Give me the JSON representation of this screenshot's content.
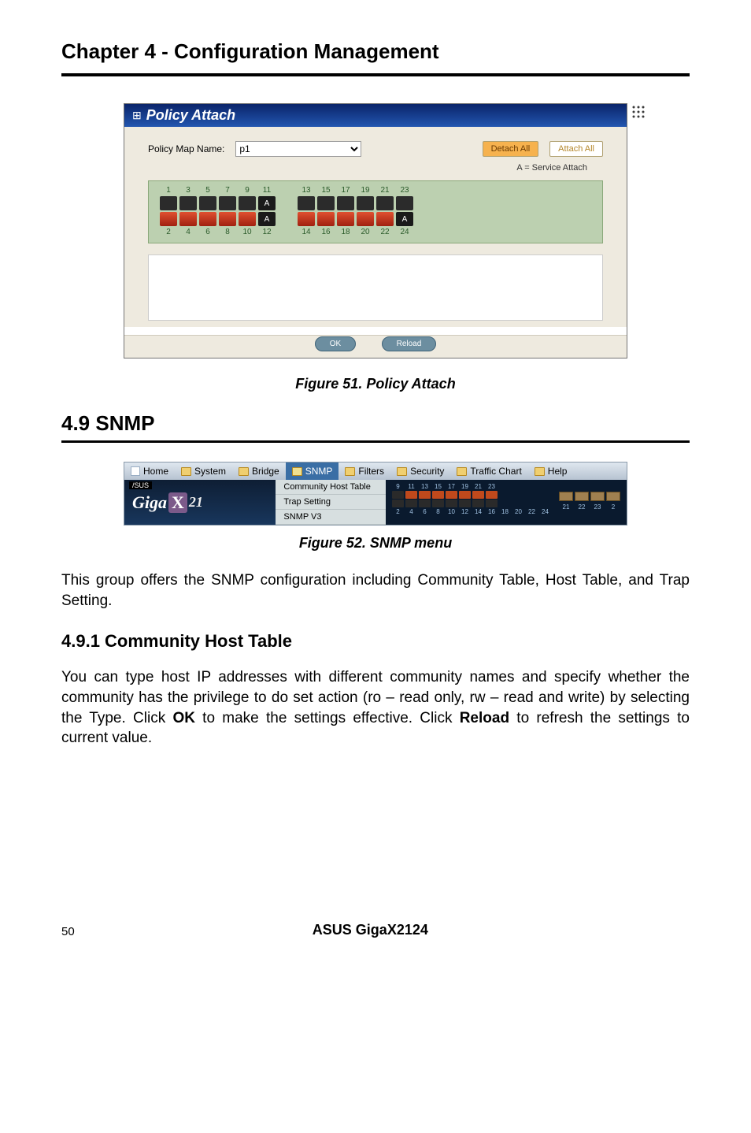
{
  "chapter_title": "Chapter 4 - Configuration Management",
  "fig51": {
    "window_title": "Policy Attach",
    "pm_label": "Policy Map Name:",
    "pm_value": "p1",
    "detach_btn": "Detach All",
    "attach_btn": "Attach All",
    "note": "A = Service Attach",
    "top_labels_g1": [
      "1",
      "3",
      "5",
      "7",
      "9",
      "11"
    ],
    "top_labels_g2": [
      "13",
      "15",
      "17",
      "19",
      "21",
      "23"
    ],
    "bot_labels_g1": [
      "2",
      "4",
      "6",
      "8",
      "10",
      "12"
    ],
    "bot_labels_g2": [
      "14",
      "16",
      "18",
      "20",
      "22",
      "24"
    ],
    "a_label": "A",
    "ok_btn": "OK",
    "reload_btn": "Reload"
  },
  "caption51": "Figure 51. Policy Attach",
  "section_head": "4.9 SNMP",
  "fig52": {
    "menu": {
      "home": "Home",
      "system": "System",
      "bridge": "Bridge",
      "snmp": "SNMP",
      "filters": "Filters",
      "security": "Security",
      "traffic": "Traffic Chart",
      "help": "Help"
    },
    "asus_logo": "/SUS",
    "logo_giga": "Giga",
    "logo_x": "X",
    "logo_21": "21",
    "dropdown": {
      "community": "Community Host Table",
      "trap": "Trap Setting",
      "snmpv3": "SNMP V3"
    },
    "top_nums": [
      "9",
      "11",
      "13",
      "15",
      "17",
      "19",
      "21",
      "23"
    ],
    "bot_nums": [
      "2",
      "4",
      "6",
      "8",
      "10",
      "12",
      "14",
      "16",
      "18",
      "20",
      "22",
      "24"
    ],
    "rt_nums": [
      "21",
      "22",
      "23",
      "2"
    ]
  },
  "caption52": "Figure 52. SNMP menu",
  "para1": "This group offers the SNMP configuration including Community Table, Host Table, and Trap Setting.",
  "subhead": "4.9.1   Community Host Table",
  "para2_a": "You can type host IP addresses with different community names and specify whether the community has the privilege to do set action (ro – read only, rw – read and write) by selecting the Type. Click ",
  "para2_ok": "OK",
  "para2_b": " to make the settings effective. Click ",
  "para2_reload": "Reload",
  "para2_c": " to refresh the settings to current value.",
  "footer": {
    "page": "50",
    "product": "ASUS GigaX2124"
  }
}
